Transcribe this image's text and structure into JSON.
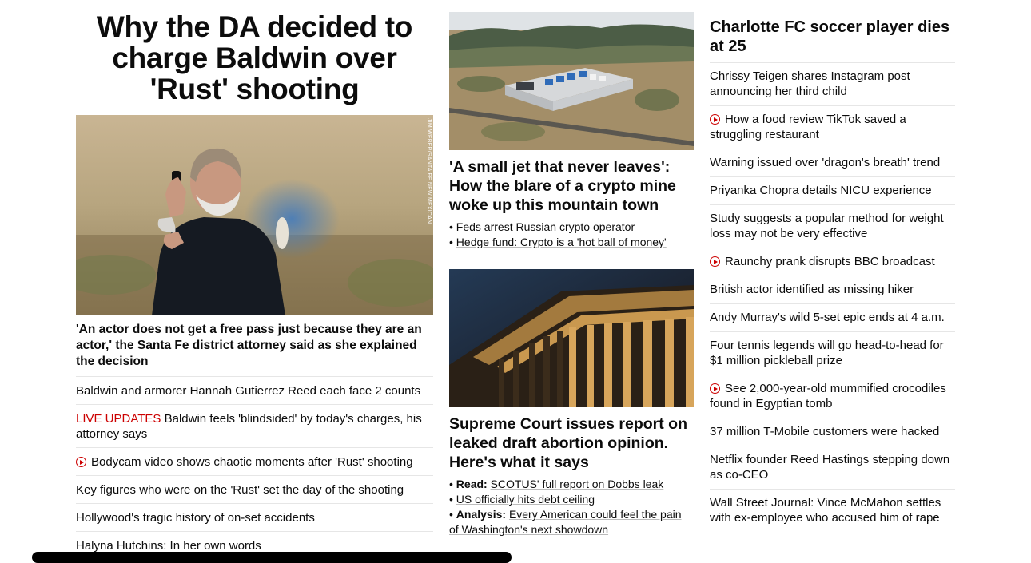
{
  "lead": {
    "headline": "Why the DA decided to charge Baldwin over 'Rust' shooting",
    "photo_credit": "JIM WEBER/SANTA FE NEW MEXICAN",
    "caption": "'An actor does not get a free pass just because they are an actor,' the Santa Fe district attorney said as she explained the decision",
    "stories": [
      {
        "text": "Baldwin and armorer Hannah Gutierrez Reed each face 2 counts"
      },
      {
        "badge": "LIVE UPDATES",
        "text": "Baldwin feels 'blindsided' by today's charges, his attorney says"
      },
      {
        "icon": "play-icon",
        "text": "Bodycam video shows chaotic moments after 'Rust' shooting"
      },
      {
        "text": "Key figures who were on the 'Rust' set the day of the shooting"
      },
      {
        "text": "Hollywood's tragic history of on-set accidents"
      },
      {
        "text": "Halyna Hutchins: In her own words"
      }
    ]
  },
  "middle": [
    {
      "headline": "'A small jet that never leaves': How the blare of a crypto mine woke up this mountain town",
      "bullets": [
        {
          "prefix": "",
          "text": "Feds arrest Russian crypto operator"
        },
        {
          "prefix": "",
          "text": "Hedge fund: Crypto is a 'hot ball of money'"
        }
      ]
    },
    {
      "headline": "Supreme Court issues report on leaked draft abortion opinion. Here's what it says",
      "bullets": [
        {
          "prefix": "Read:",
          "text": "SCOTUS' full report on Dobbs leak"
        },
        {
          "prefix": "",
          "text": "US officially hits debt ceiling"
        },
        {
          "prefix": "Analysis:",
          "text": "Every American could feel the pain of Washington's next showdown"
        }
      ]
    }
  ],
  "right": {
    "headline": "Charlotte FC soccer player dies at 25",
    "stories": [
      {
        "text": "Chrissy Teigen shares Instagram post announcing her third child"
      },
      {
        "icon": "play-icon",
        "text": "How a food review TikTok saved a struggling restaurant"
      },
      {
        "text": "Warning issued over 'dragon's breath' trend"
      },
      {
        "text": "Priyanka Chopra details NICU experience"
      },
      {
        "text": "Study suggests a popular method for weight loss may not be very effective"
      },
      {
        "icon": "play-icon",
        "text": "Raunchy prank disrupts BBC broadcast"
      },
      {
        "text": "British actor identified as missing hiker"
      },
      {
        "text": "Andy Murray's wild 5-set epic ends at 4 a.m."
      },
      {
        "text": "Four tennis legends will go head-to-head for $1 million pickleball prize"
      },
      {
        "icon": "play-icon",
        "text": "See 2,000-year-old mummified crocodiles found in Egyptian tomb"
      },
      {
        "text": "37 million T-Mobile customers were hacked"
      },
      {
        "text": "Netflix founder Reed Hastings stepping down as co-CEO"
      },
      {
        "text": "Wall Street Journal: Vince McMahon settles with ex-employee who accused him of rape"
      }
    ]
  },
  "colors": {
    "live": "#cc0000",
    "text": "#0c0c0c",
    "divider": "#e6e6e6"
  }
}
